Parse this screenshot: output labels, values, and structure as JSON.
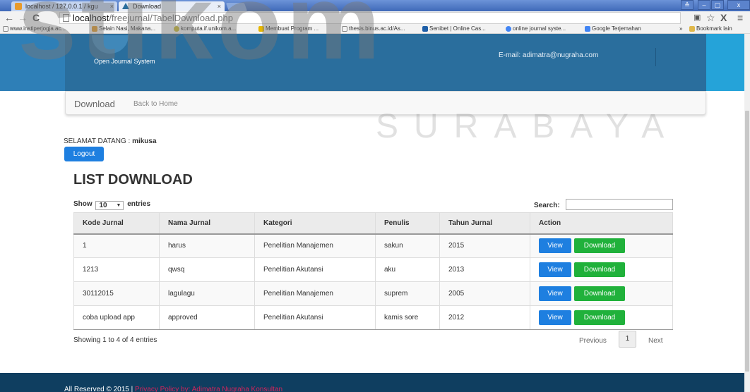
{
  "browser": {
    "tabs": [
      {
        "label": "localhost / 127.0.0.1 / kgu",
        "active": false
      },
      {
        "label": "Download",
        "active": true
      }
    ],
    "tab_close": "×",
    "window_controls": [
      "≙",
      "–",
      "▢",
      "x"
    ],
    "url_host": "localhost",
    "url_path": "/freejurnal/TabelDownload.php",
    "bookmarks": [
      "www.instiperjogja.ac...",
      "Selain Nasi, Makana...",
      "komputa.if.unikom.a...",
      "Membuat Program ...",
      "thesis.binus.ac.id/As...",
      "Senibet | Online Cas...",
      "online journal syste...",
      "Google Terjemahan",
      "»",
      "Bookmark lain"
    ],
    "bookmark_colors": [
      "#9e9e9e",
      "#e09a2b",
      "#2ba84a",
      "#e6b600",
      "#9e9e9e",
      "#1e5fa8",
      "#4285f4",
      "#4285f4",
      "#ffffff",
      "#e0b84a"
    ]
  },
  "watermark": {
    "main": "stikom",
    "sub": "SURABAYA"
  },
  "header": {
    "brand": "Open Journal System",
    "email": "E-mail: adimatra@nugraha.com"
  },
  "navbar": {
    "brand": "Download",
    "link": "Back to Home"
  },
  "welcome": {
    "label": "SELAMAT DATANG :",
    "user": "mikusa"
  },
  "logout_label": "Logout",
  "list_title": "LIST DOWNLOAD",
  "length_menu": {
    "prefix": "Show",
    "value": "10",
    "suffix": "entries"
  },
  "search": {
    "label": "Search:",
    "value": ""
  },
  "table": {
    "columns": [
      "Kode Jurnal",
      "Nama Jurnal",
      "Kategori",
      "Penulis",
      "Tahun Jurnal",
      "Action"
    ],
    "rows": [
      [
        "1",
        "harus",
        "Penelitian Manajemen",
        "sakun",
        "2015"
      ],
      [
        "1213",
        "qwsq",
        "Penelitian Akutansi",
        "aku",
        "2013"
      ],
      [
        "30112015",
        "lagulagu",
        "Penelitian Manajemen",
        "suprem",
        "2005"
      ],
      [
        "coba upload app",
        "approved",
        "Penelitian Akutansi",
        "kamis sore",
        "2012"
      ]
    ],
    "view_label": "View",
    "download_label": "Download"
  },
  "info": "Showing 1 to 4 of 4 entries",
  "pagination": {
    "previous": "Previous",
    "current": "1",
    "next": "Next"
  },
  "footer": {
    "text": "All Reserved © 2015 |",
    "link": "Privacy Policy by: Adimatra Nugraha Konsultan"
  },
  "colors": {
    "primary_button": "#1e7fe0",
    "success_button": "#20b13b",
    "header_bg": "#2e7fb7",
    "footer_bg": "#0f3e60",
    "footer_link": "#d4245c"
  }
}
